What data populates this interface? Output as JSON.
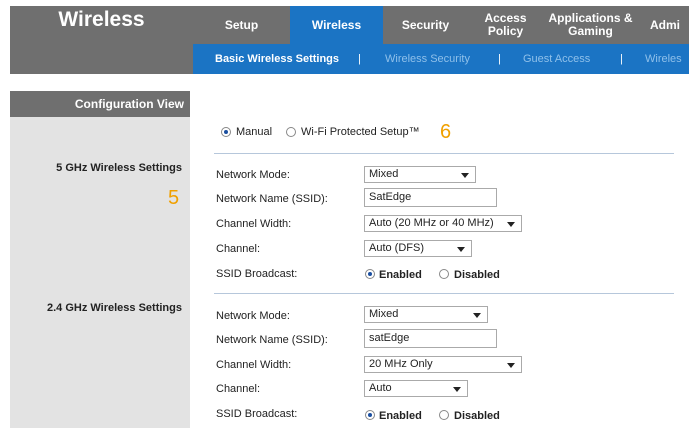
{
  "app": {
    "title": "Wireless"
  },
  "top_nav": [
    {
      "label": "Setup",
      "active": false
    },
    {
      "label": "Wireless",
      "active": true
    },
    {
      "label": "Security",
      "active": false
    },
    {
      "label": "Access Policy",
      "active": false
    },
    {
      "label": "Applications & Gaming",
      "active": false
    },
    {
      "label": "Admi",
      "active": false
    }
  ],
  "sub_nav": {
    "items": [
      "Basic Wireless Settings",
      "Wireless Security",
      "Guest Access",
      "Wireles"
    ],
    "separator": "|"
  },
  "sidebar": {
    "config_view_label": "Configuration View",
    "section_5ghz": "5 GHz Wireless Settings",
    "section_24ghz": "2.4 GHz Wireless Settings"
  },
  "annotations": {
    "badge_5": "5",
    "badge_6": "6"
  },
  "config_mode": {
    "manual_label": "Manual",
    "wps_label": "Wi-Fi Protected Setup™",
    "selected": "Manual"
  },
  "labels": {
    "network_mode": "Network Mode:",
    "network_name": "Network Name (SSID):",
    "channel_width": "Channel Width:",
    "channel": "Channel:",
    "ssid_broadcast": "SSID Broadcast:",
    "enabled": "Enabled",
    "disabled": "Disabled"
  },
  "band_5ghz": {
    "network_mode": "Mixed",
    "ssid": "SatEdge",
    "channel_width": "Auto (20 MHz or 40 MHz)",
    "channel": "Auto (DFS)",
    "ssid_broadcast": "Enabled"
  },
  "band_24ghz": {
    "network_mode": "Mixed",
    "ssid": "satEdge",
    "channel_width": "20 MHz Only",
    "channel": "Auto",
    "ssid_broadcast": "Enabled"
  },
  "colors": {
    "header_gray": "#6f6f6f",
    "accent_blue": "#1b74c4",
    "sidebar_gray": "#e3e3e3",
    "badge_orange": "#f0a000"
  }
}
